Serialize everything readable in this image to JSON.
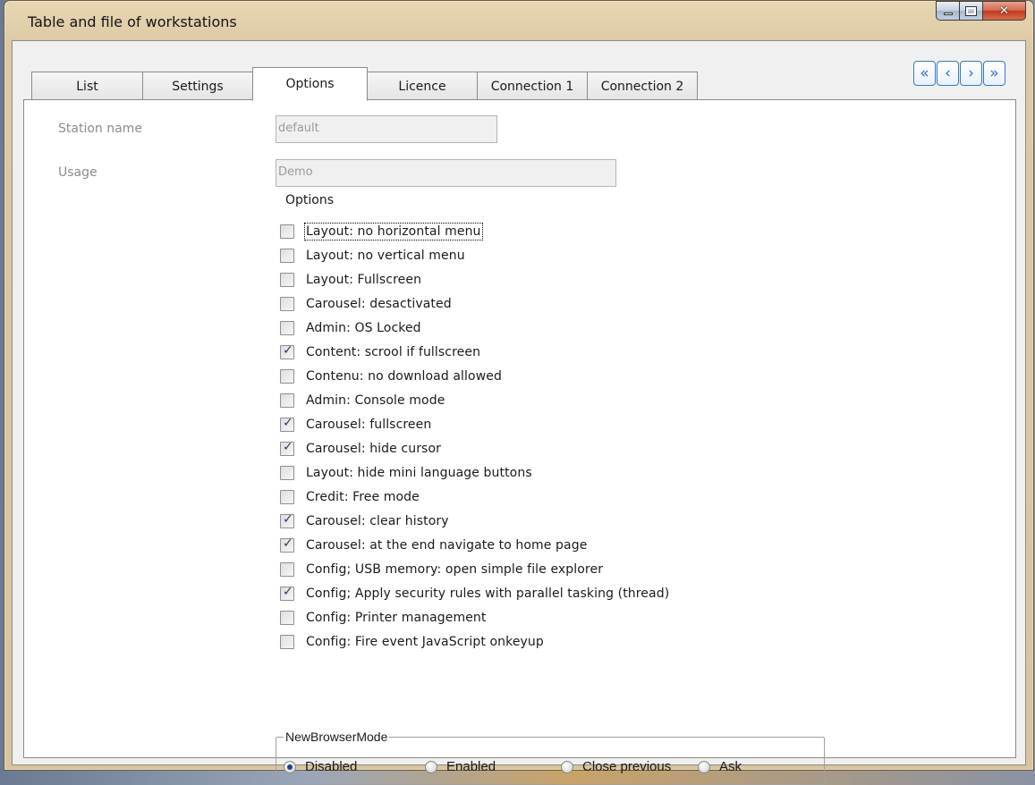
{
  "window": {
    "title": "Table and file of workstations",
    "controls": {
      "minimize": "minimize",
      "maximize": "maximize",
      "close": "close"
    }
  },
  "tabs": [
    {
      "label": "List",
      "active": false
    },
    {
      "label": "Settings",
      "active": false
    },
    {
      "label": "Options",
      "active": true
    },
    {
      "label": "Licence",
      "active": false
    },
    {
      "label": "Connection 1",
      "active": false
    },
    {
      "label": "Connection 2",
      "active": false
    }
  ],
  "nav_buttons": {
    "first": "«",
    "prev": "‹",
    "next": "›",
    "last": "»"
  },
  "fields": {
    "station_name": {
      "label": "Station name",
      "value": "default"
    },
    "usage": {
      "label": "Usage",
      "value": "Demo"
    }
  },
  "options": {
    "title": "Options",
    "items": [
      {
        "label": "Layout: no horizontal menu",
        "checked": false
      },
      {
        "label": "Layout: no vertical menu",
        "checked": false
      },
      {
        "label": "Layout: Fullscreen",
        "checked": false
      },
      {
        "label": "Carousel: desactivated",
        "checked": false
      },
      {
        "label": "Admin: OS Locked",
        "checked": false
      },
      {
        "label": "Content: scrool if fullscreen",
        "checked": true
      },
      {
        "label": "Contenu: no download allowed",
        "checked": false
      },
      {
        "label": "Admin: Console mode",
        "checked": false
      },
      {
        "label": "Carousel: fullscreen",
        "checked": true
      },
      {
        "label": "Carousel: hide cursor",
        "checked": true
      },
      {
        "label": "Layout: hide mini language buttons",
        "checked": false
      },
      {
        "label": "Credit: Free mode",
        "checked": false
      },
      {
        "label": "Carousel: clear history",
        "checked": true
      },
      {
        "label": "Carousel: at the end navigate to home page",
        "checked": true
      },
      {
        "label": "Config; USB memory: open simple file explorer",
        "checked": false
      },
      {
        "label": "Config; Apply security rules with parallel tasking (thread)",
        "checked": true
      },
      {
        "label": "Config: Printer management",
        "checked": false
      },
      {
        "label": "Config: Fire event JavaScript onkeyup",
        "checked": false
      }
    ]
  },
  "new_browser_mode": {
    "legend": "NewBrowserMode",
    "options": [
      {
        "label": "Disabled",
        "selected": true
      },
      {
        "label": "Enabled",
        "selected": false
      },
      {
        "label": "Close previous",
        "selected": false
      },
      {
        "label": "Ask",
        "selected": false
      }
    ]
  }
}
